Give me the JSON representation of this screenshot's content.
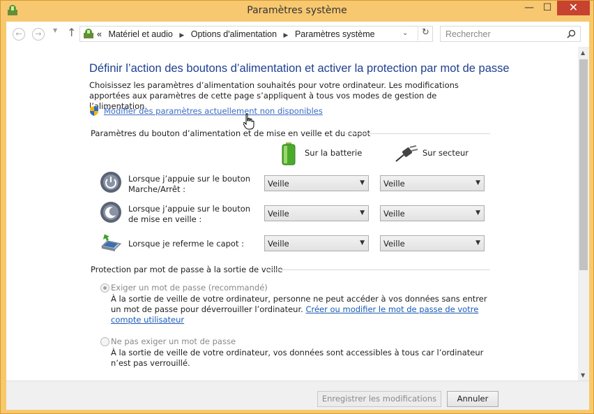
{
  "window": {
    "title": "Paramètres système",
    "minimize_label": "—",
    "maximize_label": "☐",
    "close_label": "✕"
  },
  "nav": {
    "back_label": "←",
    "forward_label": "→",
    "up_label": "↑",
    "breadcrumb": {
      "overflow": "«",
      "item1": "Matériel et audio",
      "item2": "Options d'alimentation",
      "item3": "Paramètres système"
    },
    "search_placeholder": "Rechercher"
  },
  "main": {
    "heading": "Définir l’action des boutons d’alimentation et activer la protection par mot de passe",
    "description": "Choisissez les paramètres d’alimentation souhaités pour votre ordinateur. Les modifications apportées aux paramètres de cette page s’appliquent à tous vos modes de gestion de l’alimentation.",
    "modify_link": "Modifier des paramètres actuellement non disponibles",
    "buttons_section": {
      "title": "Paramètres du bouton d’alimentation et de mise en veille et du capot",
      "battery_header": "Sur la batterie",
      "plugged_header": "Sur secteur",
      "rows": [
        {
          "label": "Lorsque j’appuie sur le bouton Marche/Arrêt :",
          "battery": "Veille",
          "plugged": "Veille"
        },
        {
          "label": "Lorsque j’appuie sur le bouton de mise en veille :",
          "battery": "Veille",
          "plugged": "Veille"
        },
        {
          "label": "Lorsque je referme le capot :",
          "battery": "Veille",
          "plugged": "Veille"
        }
      ]
    },
    "password_section": {
      "title": "Protection par mot de passe à la sortie de veille",
      "require_label": "Exiger un mot de passe (recommandé)",
      "require_desc": "À la sortie de veille de votre ordinateur, personne ne peut accéder à vos données sans entrer un mot de passe pour déverrouiller l’ordinateur.",
      "require_link": "Créer ou modifier le mot de passe de votre compte utilisateur",
      "norequire_label": "Ne pas exiger un mot de passe",
      "norequire_desc": "À la sortie de veille de votre ordinateur, vos données sont accessibles à tous car l’ordinateur n’est pas verrouillé."
    }
  },
  "footer": {
    "save_label": "Enregistrer les modifications",
    "cancel_label": "Annuler"
  }
}
